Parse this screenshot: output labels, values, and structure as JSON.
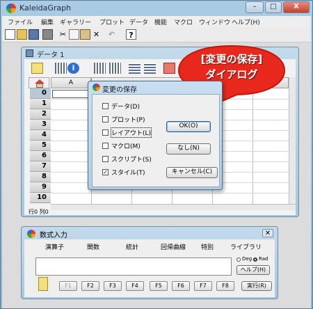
{
  "app": {
    "title": "KaleidaGraph"
  },
  "window_controls": {
    "minimize": "–",
    "maximize": "□",
    "close": "X"
  },
  "menu": [
    "ファイル",
    "編集",
    "ギャラリー",
    "プロット",
    "データ",
    "機能",
    "マクロ",
    "ウィンドウ",
    "ヘルプ(H)"
  ],
  "toolbar_icons": [
    "new-file-icon",
    "open-folder-icon",
    "save-icon",
    "print-icon",
    "cut-icon",
    "copy-icon",
    "paste-icon",
    "delete-icon",
    "undo-icon",
    "help-icon"
  ],
  "toolbar_glyphs": {
    "delete": "✕",
    "help": "?"
  },
  "data_window": {
    "title": "データ 1",
    "column_header": "A",
    "row_labels": [
      "0",
      "1",
      "2",
      "3",
      "4",
      "5",
      "6",
      "7",
      "8",
      "9",
      "10"
    ],
    "status": "行0  列0"
  },
  "dialog": {
    "title": "変更の保存",
    "options": [
      {
        "label": "データ(D)",
        "checked": false
      },
      {
        "label": "プロット(P)",
        "checked": false
      },
      {
        "label": "レイアウト(L)",
        "checked": false
      },
      {
        "label": "マクロ(M)",
        "checked": false
      },
      {
        "label": "スクリプト(S)",
        "checked": false
      },
      {
        "label": "スタイル(T)",
        "checked": true
      }
    ],
    "check_mark": "✓",
    "ok_label": "OK(O)",
    "none_label": "なし(N)",
    "cancel_label": "キャンセル(C)"
  },
  "callout": {
    "line1": "[変更の保存]",
    "line2": "ダイアログ",
    "color": "#e8281c"
  },
  "formula_window": {
    "title": "数式入力",
    "close": "✕",
    "menu": [
      "演算子",
      "関数",
      "統計",
      "回帰曲線",
      "特別",
      "ライブラリ"
    ],
    "angle_deg": "Deg",
    "angle_rad": "Rad",
    "help_label": "ヘルプ(H)",
    "fkeys": [
      "F1",
      "F2",
      "F3",
      "F4",
      "F5",
      "F6",
      "F7",
      "F8"
    ],
    "run_label": "実行(R)"
  }
}
